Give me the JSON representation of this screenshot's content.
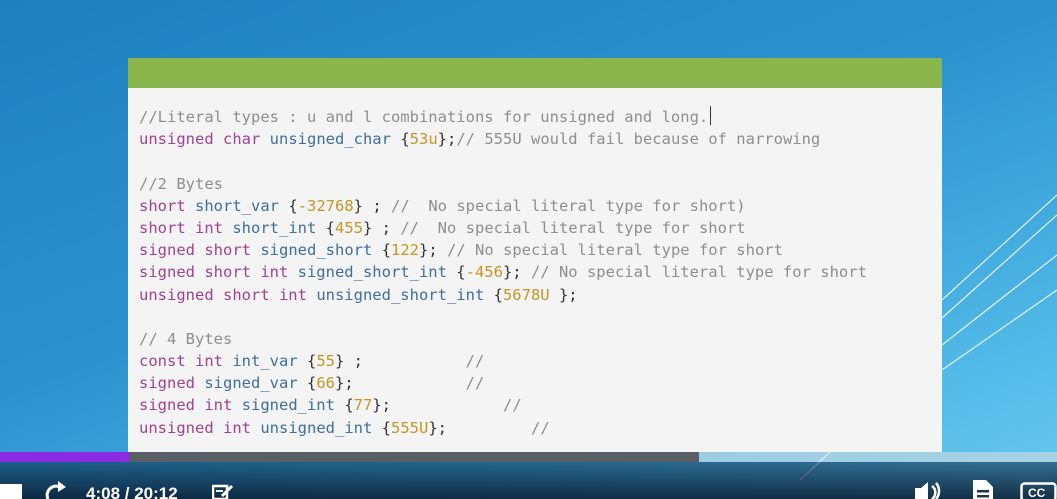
{
  "player": {
    "current_time": "4:08",
    "time_separator": " / ",
    "duration": "20:12",
    "progress_fraction": 0.1228,
    "buffered_fraction": 0.6613,
    "cc_label": "CC"
  },
  "code": {
    "lines": [
      [
        {
          "t": "//Literal types : u and l combinations for unsigned and long.",
          "c": "cm"
        }
      ],
      [
        {
          "t": "unsigned char ",
          "c": "kw"
        },
        {
          "t": "unsigned_char ",
          "c": "id"
        },
        {
          "t": "{",
          "c": "op"
        },
        {
          "t": "53u",
          "c": "num"
        },
        {
          "t": "};",
          "c": "op"
        },
        {
          "t": "// 555U would fail because of narrowing",
          "c": "cm"
        }
      ],
      [],
      [
        {
          "t": "//2 Bytes",
          "c": "cm"
        }
      ],
      [
        {
          "t": "short ",
          "c": "kw"
        },
        {
          "t": "short_var ",
          "c": "id"
        },
        {
          "t": "{",
          "c": "op"
        },
        {
          "t": "-32768",
          "c": "num"
        },
        {
          "t": "} ; ",
          "c": "op"
        },
        {
          "t": "//  No special literal type for short)",
          "c": "cm"
        }
      ],
      [
        {
          "t": "short int ",
          "c": "kw"
        },
        {
          "t": "short_int ",
          "c": "id"
        },
        {
          "t": "{",
          "c": "op"
        },
        {
          "t": "455",
          "c": "num"
        },
        {
          "t": "} ; ",
          "c": "op"
        },
        {
          "t": "//  No special literal type for short",
          "c": "cm"
        }
      ],
      [
        {
          "t": "signed short ",
          "c": "kw"
        },
        {
          "t": "signed_short ",
          "c": "id"
        },
        {
          "t": "{",
          "c": "op"
        },
        {
          "t": "122",
          "c": "num"
        },
        {
          "t": "}; ",
          "c": "op"
        },
        {
          "t": "// No special literal type for short",
          "c": "cm"
        }
      ],
      [
        {
          "t": "signed short int ",
          "c": "kw"
        },
        {
          "t": "signed_short_int ",
          "c": "id"
        },
        {
          "t": "{",
          "c": "op"
        },
        {
          "t": "-456",
          "c": "num"
        },
        {
          "t": "}; ",
          "c": "op"
        },
        {
          "t": "// No special literal type for short",
          "c": "cm"
        }
      ],
      [
        {
          "t": "unsigned short int ",
          "c": "kw"
        },
        {
          "t": "unsigned_short_int ",
          "c": "id"
        },
        {
          "t": "{",
          "c": "op"
        },
        {
          "t": "5678U",
          "c": "num"
        },
        {
          "t": " };",
          "c": "op"
        }
      ],
      [],
      [
        {
          "t": "// 4 Bytes",
          "c": "cm"
        }
      ],
      [
        {
          "t": "const int ",
          "c": "kw"
        },
        {
          "t": "int_var ",
          "c": "id"
        },
        {
          "t": "{",
          "c": "op"
        },
        {
          "t": "55",
          "c": "num"
        },
        {
          "t": "} ;           ",
          "c": "op"
        },
        {
          "t": "//",
          "c": "cm"
        }
      ],
      [
        {
          "t": "signed ",
          "c": "kw"
        },
        {
          "t": "signed_var ",
          "c": "id"
        },
        {
          "t": "{",
          "c": "op"
        },
        {
          "t": "66",
          "c": "num"
        },
        {
          "t": "};            ",
          "c": "op"
        },
        {
          "t": "//",
          "c": "cm"
        }
      ],
      [
        {
          "t": "signed int ",
          "c": "kw"
        },
        {
          "t": "signed_int ",
          "c": "id"
        },
        {
          "t": "{",
          "c": "op"
        },
        {
          "t": "77",
          "c": "num"
        },
        {
          "t": "};            ",
          "c": "op"
        },
        {
          "t": "//",
          "c": "cm"
        }
      ],
      [
        {
          "t": "unsigned int ",
          "c": "kw"
        },
        {
          "t": "unsigned_int ",
          "c": "id"
        },
        {
          "t": "{",
          "c": "op"
        },
        {
          "t": "555U",
          "c": "num"
        },
        {
          "t": "};         ",
          "c": "op"
        },
        {
          "t": "//",
          "c": "cm"
        }
      ]
    ]
  },
  "colors": {
    "slide_header": "#8bb54d",
    "keyword": "#a2418f",
    "identifier": "#3e6f9a",
    "number": "#c49622",
    "comment": "#8e8e8e",
    "progress_played": "#8a2be2"
  },
  "icons": {
    "replay": "replay-icon",
    "notes": "notes-icon",
    "volume": "volume-icon",
    "transcript": "transcript-icon",
    "captions": "captions-icon"
  }
}
